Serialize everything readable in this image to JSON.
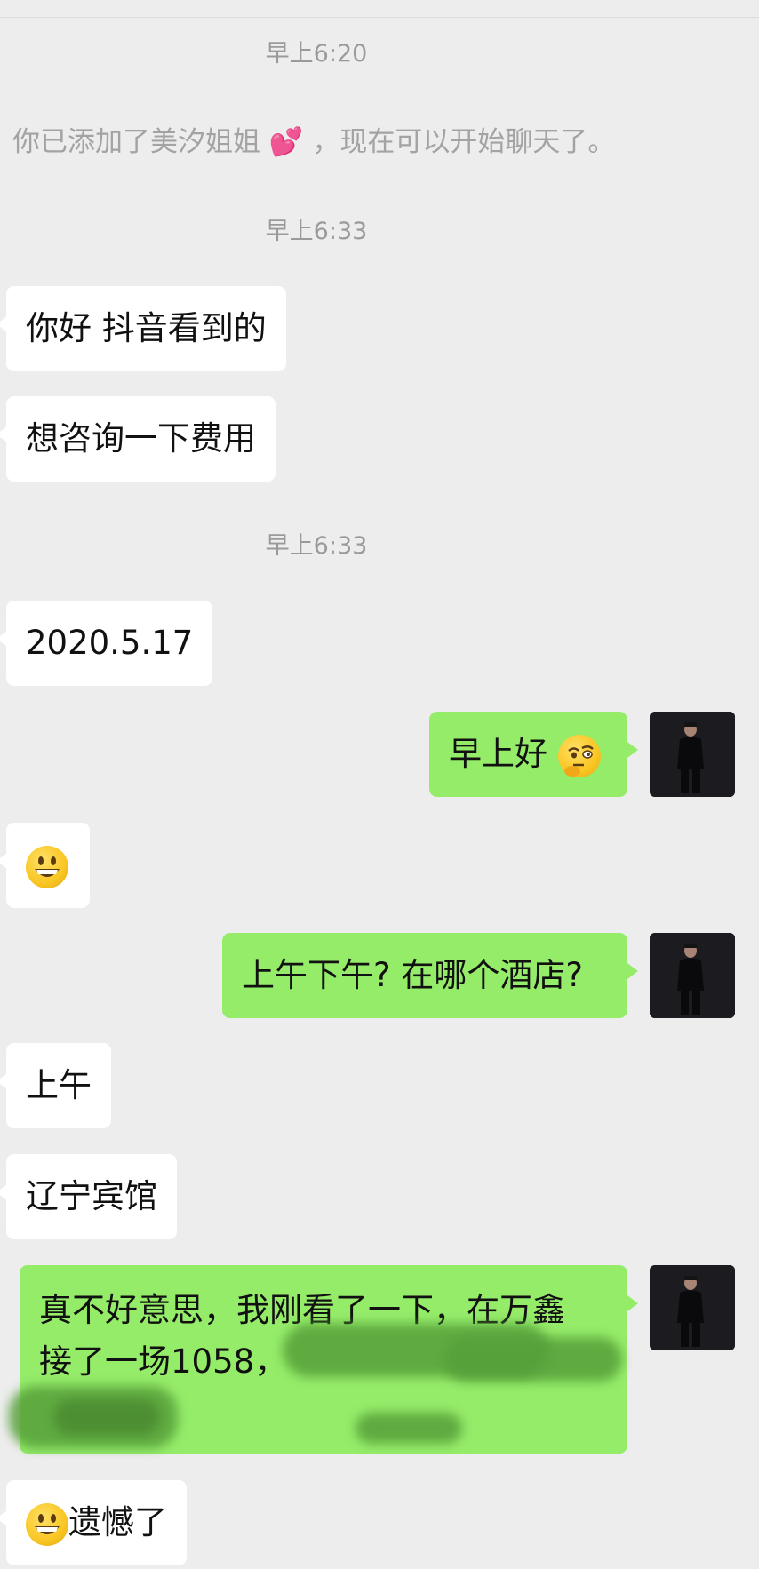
{
  "timestamps": [
    "早上6:20",
    "早上6:33",
    "早上6:33"
  ],
  "system_message": {
    "prefix": "你已添加了美汐姐姐",
    "emoji": "💕",
    "suffix": "，现在可以开始聊天了。"
  },
  "messages": [
    {
      "side": "left",
      "text": "你好 抖音看到的"
    },
    {
      "side": "left",
      "text": "想咨询一下费用"
    },
    {
      "side": "left",
      "text": "2020.5.17"
    },
    {
      "side": "right",
      "text": "早上好",
      "emoji": "face-with-monocle-thinking"
    },
    {
      "side": "left",
      "text": "",
      "emoji": "grinning-face"
    },
    {
      "side": "right",
      "text": "上午下午? 在哪个酒店?"
    },
    {
      "side": "left",
      "text": "上午"
    },
    {
      "side": "left",
      "text": "辽宁宾馆"
    },
    {
      "side": "right",
      "line1": "真不好意思，我刚看了一下，在万鑫",
      "line2": "接了一场1058，",
      "redacted": true
    },
    {
      "side": "left",
      "text": "遗憾了",
      "emoji": "grinning-face"
    }
  ],
  "colors": {
    "background": "#ededed",
    "left_bubble": "#ffffff",
    "right_bubble": "#95ec69",
    "timestamp": "#9a9a9a"
  }
}
